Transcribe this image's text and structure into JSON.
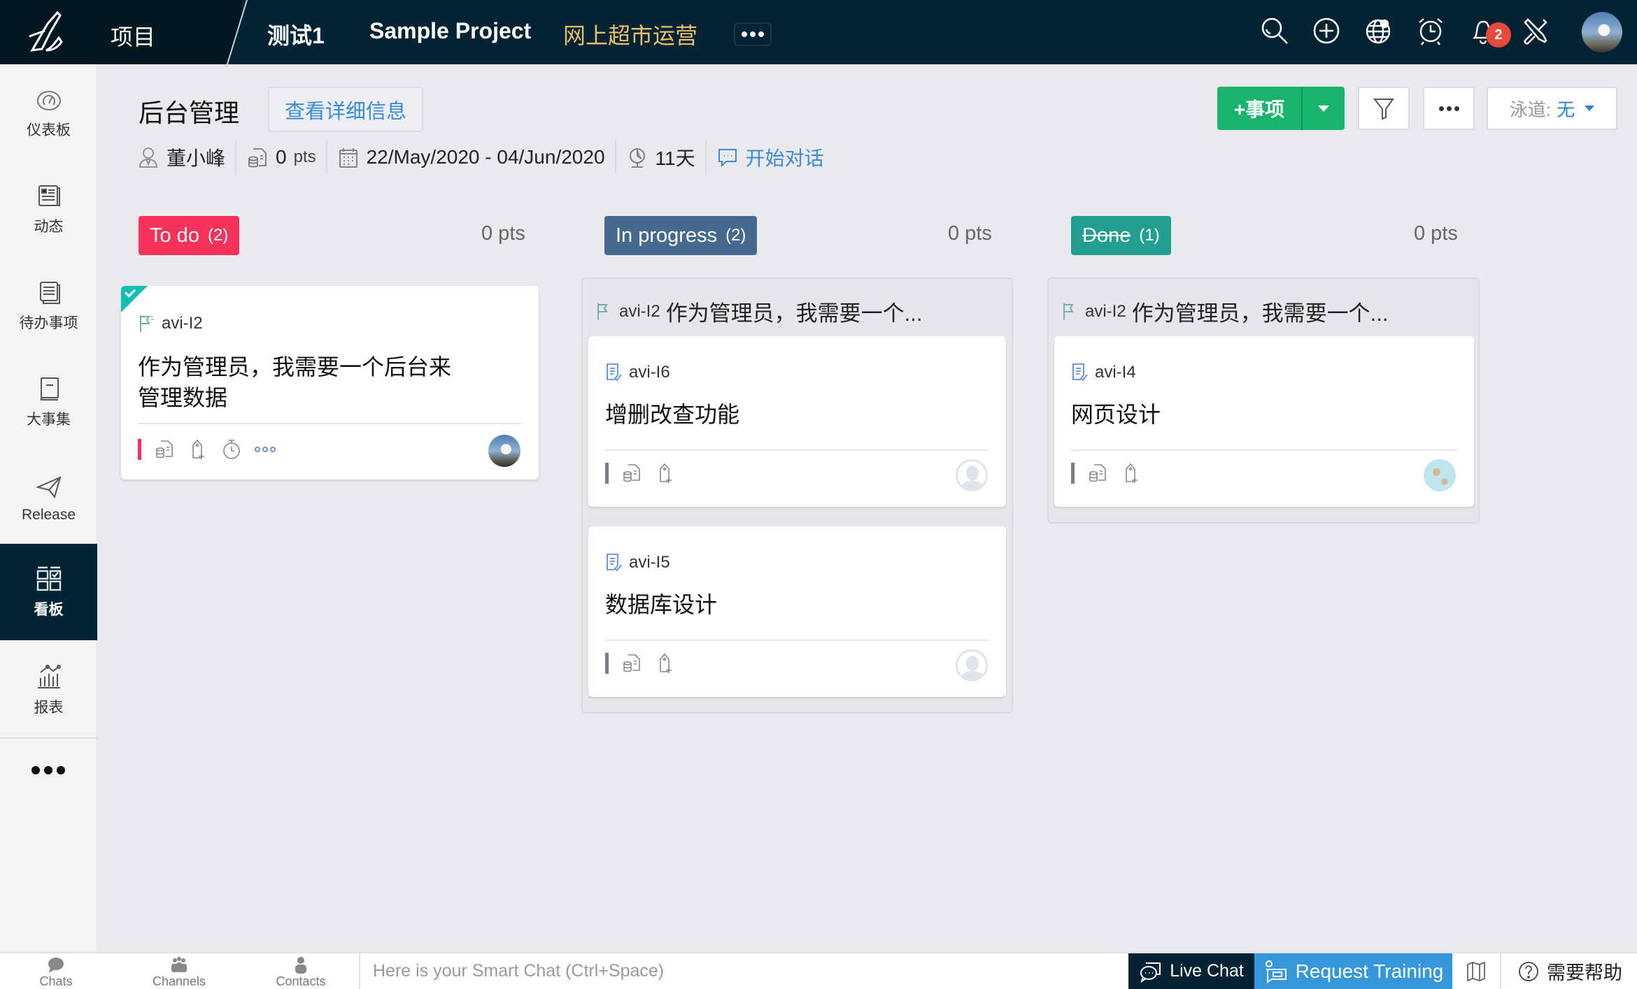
{
  "header": {
    "projects_label": "项目",
    "project_tabs": [
      {
        "label": "测试1",
        "active": false
      },
      {
        "label": "Sample Project",
        "active": false
      },
      {
        "label": "网上超市运营",
        "active": true
      }
    ],
    "notification_count": "2",
    "icons": [
      "search-icon",
      "add-circle-icon",
      "globe-eye-icon",
      "alarm-clock-icon",
      "bell-icon",
      "tools-icon"
    ]
  },
  "sidebar": {
    "items": [
      {
        "label": "仪表板",
        "icon": "dashboard-gauge-icon",
        "active": false
      },
      {
        "label": "动态",
        "icon": "feed-icon",
        "active": false
      },
      {
        "label": "待办事项",
        "icon": "backlog-icon",
        "active": false
      },
      {
        "label": "大事集",
        "icon": "epic-book-icon",
        "active": false
      },
      {
        "label": "Release",
        "icon": "paper-plane-icon",
        "active": false
      },
      {
        "label": "看板",
        "icon": "board-grid-icon",
        "active": true
      },
      {
        "label": "报表",
        "icon": "report-chart-icon",
        "active": false
      }
    ]
  },
  "page": {
    "title": "后台管理",
    "detail_button": "查看详细信息",
    "owner": "董小峰",
    "points_value": "0",
    "points_unit": "pts",
    "date_range": "22/May/2020 - 04/Jun/2020",
    "duration": "11天",
    "start_chat": "开始对话"
  },
  "toolbar": {
    "add_item_label": "+事项",
    "swimlane_label": "泳道:",
    "swimlane_value": "无"
  },
  "columns": [
    {
      "name": "To do",
      "count": "(2)",
      "points": "0 pts",
      "color": "#f6315a"
    },
    {
      "name": "In progress",
      "count": "(2)",
      "points": "0 pts",
      "color": "#46698e"
    },
    {
      "name": "Done",
      "count": "(1)",
      "points": "0 pts",
      "color": "#229f8e"
    }
  ],
  "cards": {
    "todo_story": {
      "id": "avi-I2",
      "title": "作为管理员，我需要一个后台来管理数据",
      "priority_color": "#f6315a"
    },
    "progress_group": {
      "parent_id": "avi-I2",
      "parent_title": "作为管理员，我需要一个...",
      "items": [
        {
          "id": "avi-I6",
          "title": "增删改查功能"
        },
        {
          "id": "avi-I5",
          "title": "数据库设计"
        }
      ]
    },
    "done_group": {
      "parent_id": "avi-I2",
      "parent_title": "作为管理员，我需要一个...",
      "items": [
        {
          "id": "avi-I4",
          "title": "网页设计"
        }
      ]
    }
  },
  "bottombar": {
    "tabs": [
      "Chats",
      "Channels",
      "Contacts"
    ],
    "chat_placeholder": "Here is your Smart Chat (Ctrl+Space)",
    "live_chat": "Live Chat",
    "request_training": "Request Training",
    "help": "需要帮助"
  }
}
